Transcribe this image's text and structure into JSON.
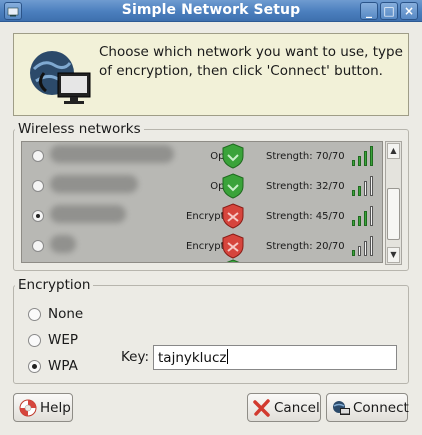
{
  "window": {
    "title": "Simple Network Setup"
  },
  "titlebar_buttons": {
    "minimize": "_",
    "maximize": "□",
    "close": "×"
  },
  "info": {
    "line1": "Choose which network you want to use, type",
    "line2": "of encryption, then click 'Connect' button."
  },
  "wireless": {
    "label": "Wireless networks",
    "networks": [
      {
        "security": "Open",
        "shield": "green-shield-icon",
        "strength": "Strength: 70/70",
        "signal_bars": 4,
        "selected": false
      },
      {
        "security": "Open",
        "shield": "green-shield-icon",
        "strength": "Strength: 32/70",
        "signal_bars": 2,
        "selected": false
      },
      {
        "security": "Encrypted",
        "shield": "red-shield-icon",
        "strength": "Strength: 45/70",
        "signal_bars": 3,
        "selected": true
      },
      {
        "security": "Encrypted",
        "shield": "red-shield-icon",
        "strength": "Strength: 20/70",
        "signal_bars": 1,
        "selected": false
      }
    ]
  },
  "encryption": {
    "label": "Encryption",
    "options": [
      {
        "label": "None",
        "selected": false
      },
      {
        "label": "WEP",
        "selected": false
      },
      {
        "label": "WPA",
        "selected": true
      }
    ],
    "key_label": "Key:",
    "key_value": "tajnyklucz"
  },
  "buttons": {
    "help": "Help",
    "cancel": "Cancel",
    "connect": "Connect"
  },
  "colors": {
    "titlebar": "#4b7fbe",
    "info_bg": "#f2f1d8",
    "open_shield": "#3aa33a",
    "encrypted_shield": "#d6453d",
    "signal_on": "#3aa33a"
  }
}
